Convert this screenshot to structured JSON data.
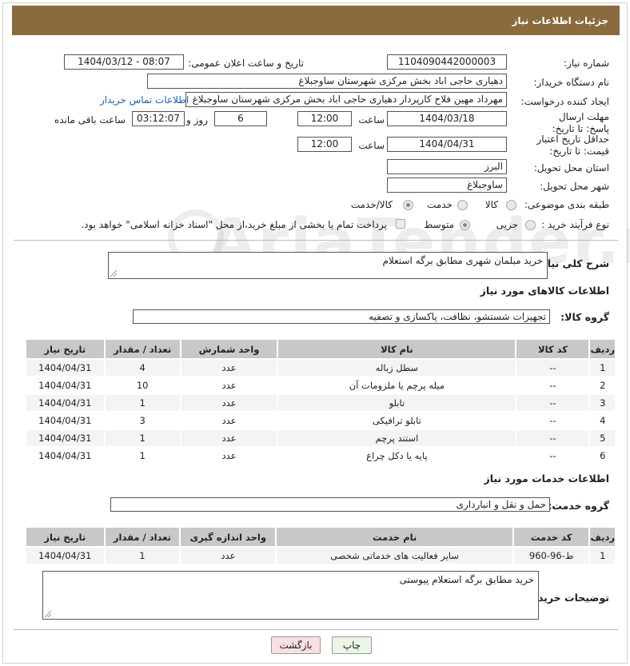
{
  "page_title": "جزئیات اطلاعات نیاز",
  "fields": {
    "need_number_label": "شماره نیاز:",
    "need_number": "1104090442000003",
    "announce_label": "تاریخ و ساعت اعلان عمومی:",
    "announce_value": "1404/03/12 - 08:07",
    "buyer_org_label": "نام دستگاه خریدار:",
    "buyer_org": "دهیاری حاجی اباد بخش مرکزی شهرستان ساوجبلاغ",
    "requester_label": "ایجاد کننده درخواست:",
    "requester": "مهرداد مهین فلاح کارپرداز دهیاری حاجی اباد بخش مرکزی شهرستان ساوجبلاغ",
    "contact_link": "اطلاعات تماس خریدار",
    "deadline_label": "مهلت ارسال پاسخ: تا تاریخ:",
    "deadline_date": "1404/03/18",
    "time_label": "ساعت",
    "deadline_time": "12:00",
    "days_value": "6",
    "days_label": "روز و",
    "remaining_time": "03:12:07",
    "remaining_label": "ساعت باقی مانده",
    "min_validity_label": "حداقل تاریخ اعتبار قیمت: تا تاریخ:",
    "validity_date": "1404/04/31",
    "validity_time": "12:00",
    "province_label": "استان محل تحویل:",
    "province": "البرز",
    "city_label": "شهر محل تحویل:",
    "city": "ساوجبلاغ",
    "category_label": "طبقه بندی موضوعی:",
    "category_options": [
      "کالا",
      "خدمت",
      "کالا/خدمت"
    ],
    "process_label": "نوع فرآیند خرید :",
    "process_options": [
      "جزیی",
      "متوسط"
    ],
    "payment_note": "پرداخت تمام یا بخشی از مبلغ خرید،از محل \"اسناد خزانه اسلامی\" خواهد بود."
  },
  "description": {
    "label": "شرح کلی نیاز:",
    "value": "خرید مبلمان شهری مطابق برگه استعلام"
  },
  "goods": {
    "section_title": "اطلاعات کالاهای مورد نیاز",
    "group_label": "گروه کالا:",
    "group_value": "تجهیزات شستشو، نظافت، پاکسازی و تصفیه",
    "headers": [
      "ردیف",
      "کد کالا",
      "نام کالا",
      "واحد شمارش",
      "تعداد / مقدار",
      "تاریخ نیاز"
    ],
    "rows": [
      [
        "1",
        "--",
        "سطل زباله",
        "عدد",
        "4",
        "1404/04/31"
      ],
      [
        "2",
        "--",
        "میله پرچم یا ملزومات آن",
        "عدد",
        "10",
        "1404/04/31"
      ],
      [
        "3",
        "--",
        "تابلو",
        "عدد",
        "1",
        "1404/04/31"
      ],
      [
        "4",
        "--",
        "تابلو ترافیکی",
        "عدد",
        "3",
        "1404/04/31"
      ],
      [
        "5",
        "--",
        "استند پرچم",
        "عدد",
        "1",
        "1404/04/31"
      ],
      [
        "6",
        "--",
        "پایه یا دکل چراغ",
        "عدد",
        "1",
        "1404/04/31"
      ]
    ]
  },
  "services": {
    "section_title": "اطلاعات خدمات مورد نیاز",
    "group_label": "گروه خدمت:",
    "group_value": "حمل و نقل و انبارداری",
    "headers": [
      "ردیف",
      "کد خدمت",
      "نام خدمت",
      "واحد اندازه گیری",
      "تعداد / مقدار",
      "تاریخ نیاز"
    ],
    "rows": [
      [
        "1",
        "ط-96-960",
        "سایر فعالیت های خدماتی شخصی",
        "عدد",
        "1",
        "1404/04/31"
      ]
    ]
  },
  "buyer_notes": {
    "label": "توضیحات خریدار:",
    "value": "خرید مطابق برگه استعلام پیوستی"
  },
  "buttons": {
    "print": "چاپ",
    "back": "بازگشت"
  },
  "watermark_text": "AriaTender.neT"
}
